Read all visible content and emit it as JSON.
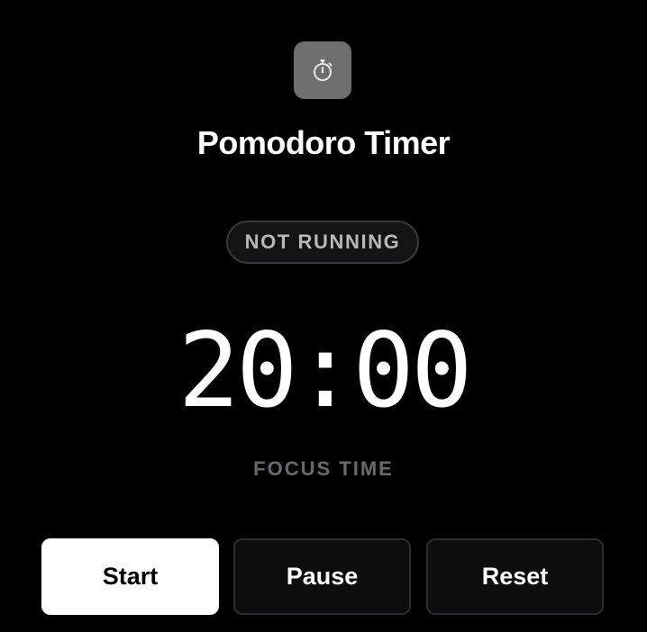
{
  "app": {
    "icon": "stopwatch-icon",
    "title": "Pomodoro Timer"
  },
  "status": {
    "label": "NOT RUNNING"
  },
  "timer": {
    "display": "20:00",
    "mode_label": "FOCUS TIME"
  },
  "controls": {
    "start_label": "Start",
    "pause_label": "Pause",
    "reset_label": "Reset"
  },
  "colors": {
    "background": "#000000",
    "icon_tile": "#6e6e6e",
    "primary_button": "#ffffff",
    "secondary_button_border": "#2c2c2e",
    "badge_text": "#b8b8bc",
    "muted_text": "#6a6a6e"
  }
}
